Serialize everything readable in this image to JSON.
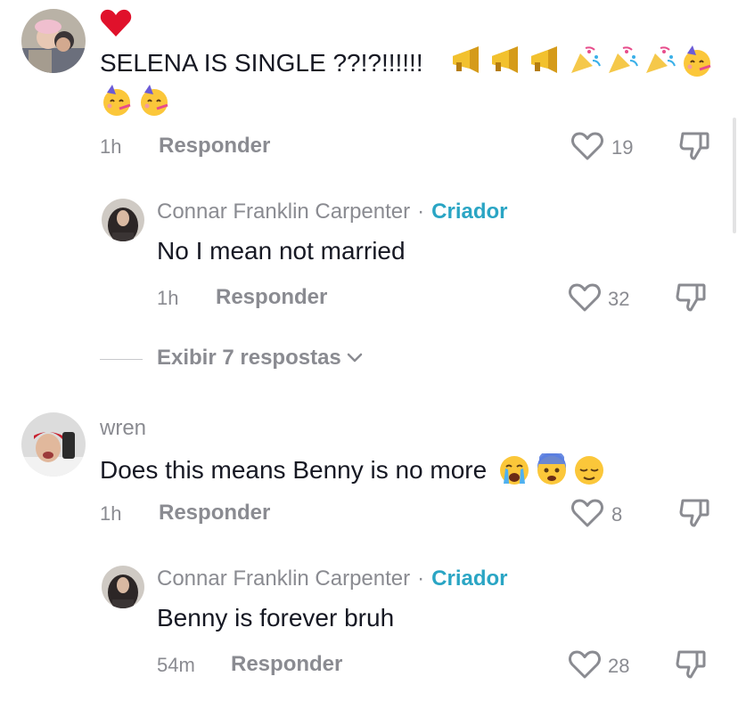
{
  "comments": [
    {
      "text": "SELENA IS SINGLE ??!?!!!!!!",
      "time": "1h",
      "reply_label": "Responder",
      "likes": "19",
      "reply": {
        "username": "Connar Franklin Carpenter",
        "separator": "·",
        "badge": "Criador",
        "text": "No I mean not married",
        "time": "1h",
        "reply_label": "Responder",
        "likes": "32"
      },
      "view_replies": "Exibir 7 respostas"
    },
    {
      "username": "wren",
      "text": "Does this means Benny is no more",
      "time": "1h",
      "reply_label": "Responder",
      "likes": "8",
      "reply": {
        "username": "Connar Franklin Carpenter",
        "separator": "·",
        "badge": "Criador",
        "text": "Benny is forever bruh",
        "time": "54m",
        "reply_label": "Responder",
        "likes": "28"
      }
    }
  ],
  "icons": {
    "heart_reaction": "red-heart-icon",
    "like": "heart-outline-icon",
    "dislike": "thumbs-down-icon",
    "expand": "chevron-down-icon"
  },
  "colors": {
    "text": "#161823",
    "muted": "#8a8b91",
    "creator_badge": "#2aa5c4",
    "heart_red": "#e0112b"
  }
}
